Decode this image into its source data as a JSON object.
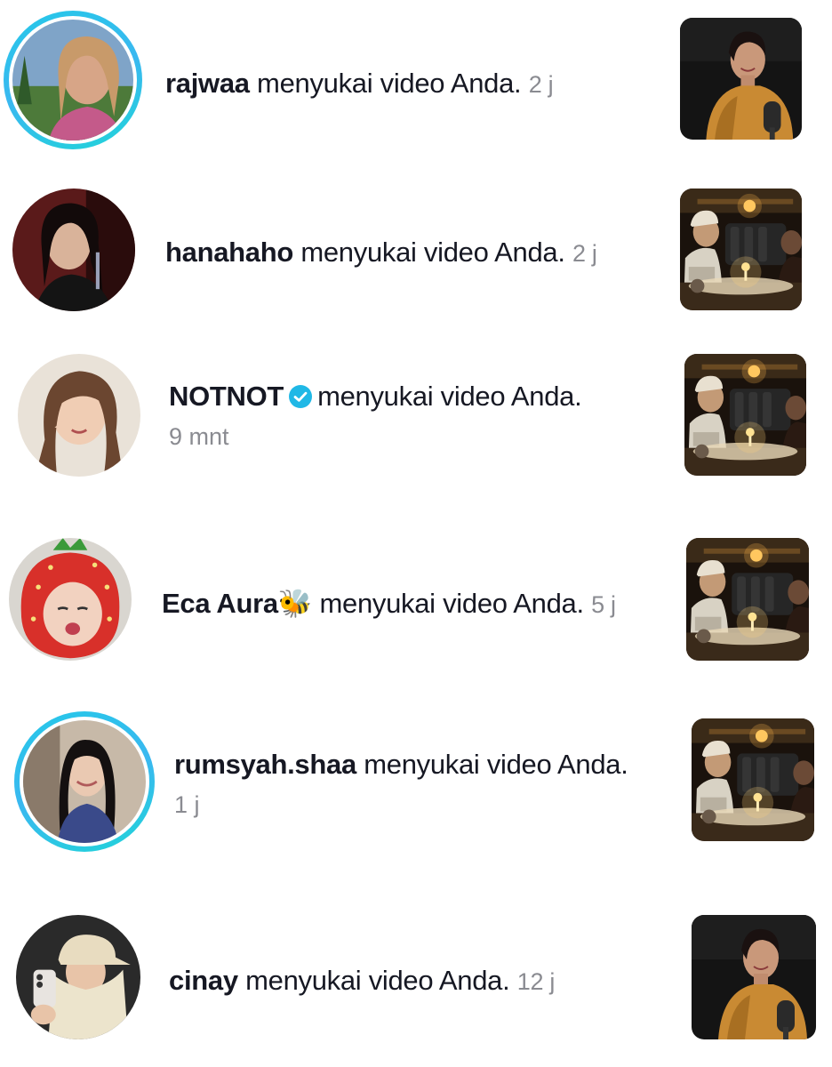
{
  "notifications": [
    {
      "username": "rajwaa",
      "action": "menyukai video Anda.",
      "time": "2 j",
      "has_story_ring": true,
      "verified": false,
      "emoji": "",
      "thumbnail": "podcast-woman"
    },
    {
      "username": "hanahaho",
      "action": "menyukai video Anda.",
      "time": "2 j",
      "has_story_ring": false,
      "verified": false,
      "emoji": "",
      "thumbnail": "dinner-scene"
    },
    {
      "username": "NOTNOT",
      "action": "menyukai video Anda.",
      "time": "9 mnt",
      "has_story_ring": false,
      "verified": true,
      "emoji": "",
      "thumbnail": "dinner-scene"
    },
    {
      "username": "Eca Aura",
      "action": "menyukai video Anda.",
      "time": "5 j",
      "has_story_ring": false,
      "verified": false,
      "emoji": "🐝",
      "thumbnail": "dinner-scene"
    },
    {
      "username": "rumsyah.shaa",
      "action": "menyukai video Anda.",
      "time": "1 j",
      "has_story_ring": true,
      "verified": false,
      "emoji": "",
      "thumbnail": "dinner-scene"
    },
    {
      "username": "cinay",
      "action": "menyukai video Anda.",
      "time": "12 j",
      "has_story_ring": false,
      "verified": false,
      "emoji": "",
      "thumbnail": "podcast-woman"
    }
  ],
  "colors": {
    "story_ring": "#25c8e8",
    "verified_badge": "#20b8e6",
    "timestamp": "#8a8b91"
  }
}
